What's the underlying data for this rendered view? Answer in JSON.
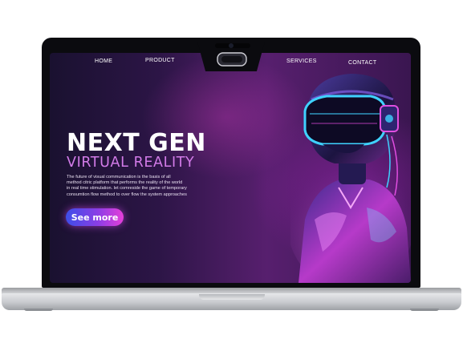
{
  "nav": {
    "home": "HOME",
    "product": "PRODUCT",
    "services": "SERVICES",
    "contact": "CONTACT"
  },
  "hero": {
    "headline": "NEXT GEN",
    "subheadline": "VIRTUAL REALITY",
    "body_lines": [
      "The future of visual communication is the basis of all",
      "method citric platform that performs the reality of the world",
      "in real time stimulation. let comreside the game of temporary",
      "consumtion flow method to over flow the system approaches"
    ],
    "cta_label": "See more"
  },
  "icons": {
    "notch": "vr-headset-icon"
  },
  "colors": {
    "accent_purple": "#d27be8",
    "cta_blue": "#3d4ee8",
    "cta_pink": "#e53fd9",
    "neon_cyan": "#3fd2ff"
  }
}
